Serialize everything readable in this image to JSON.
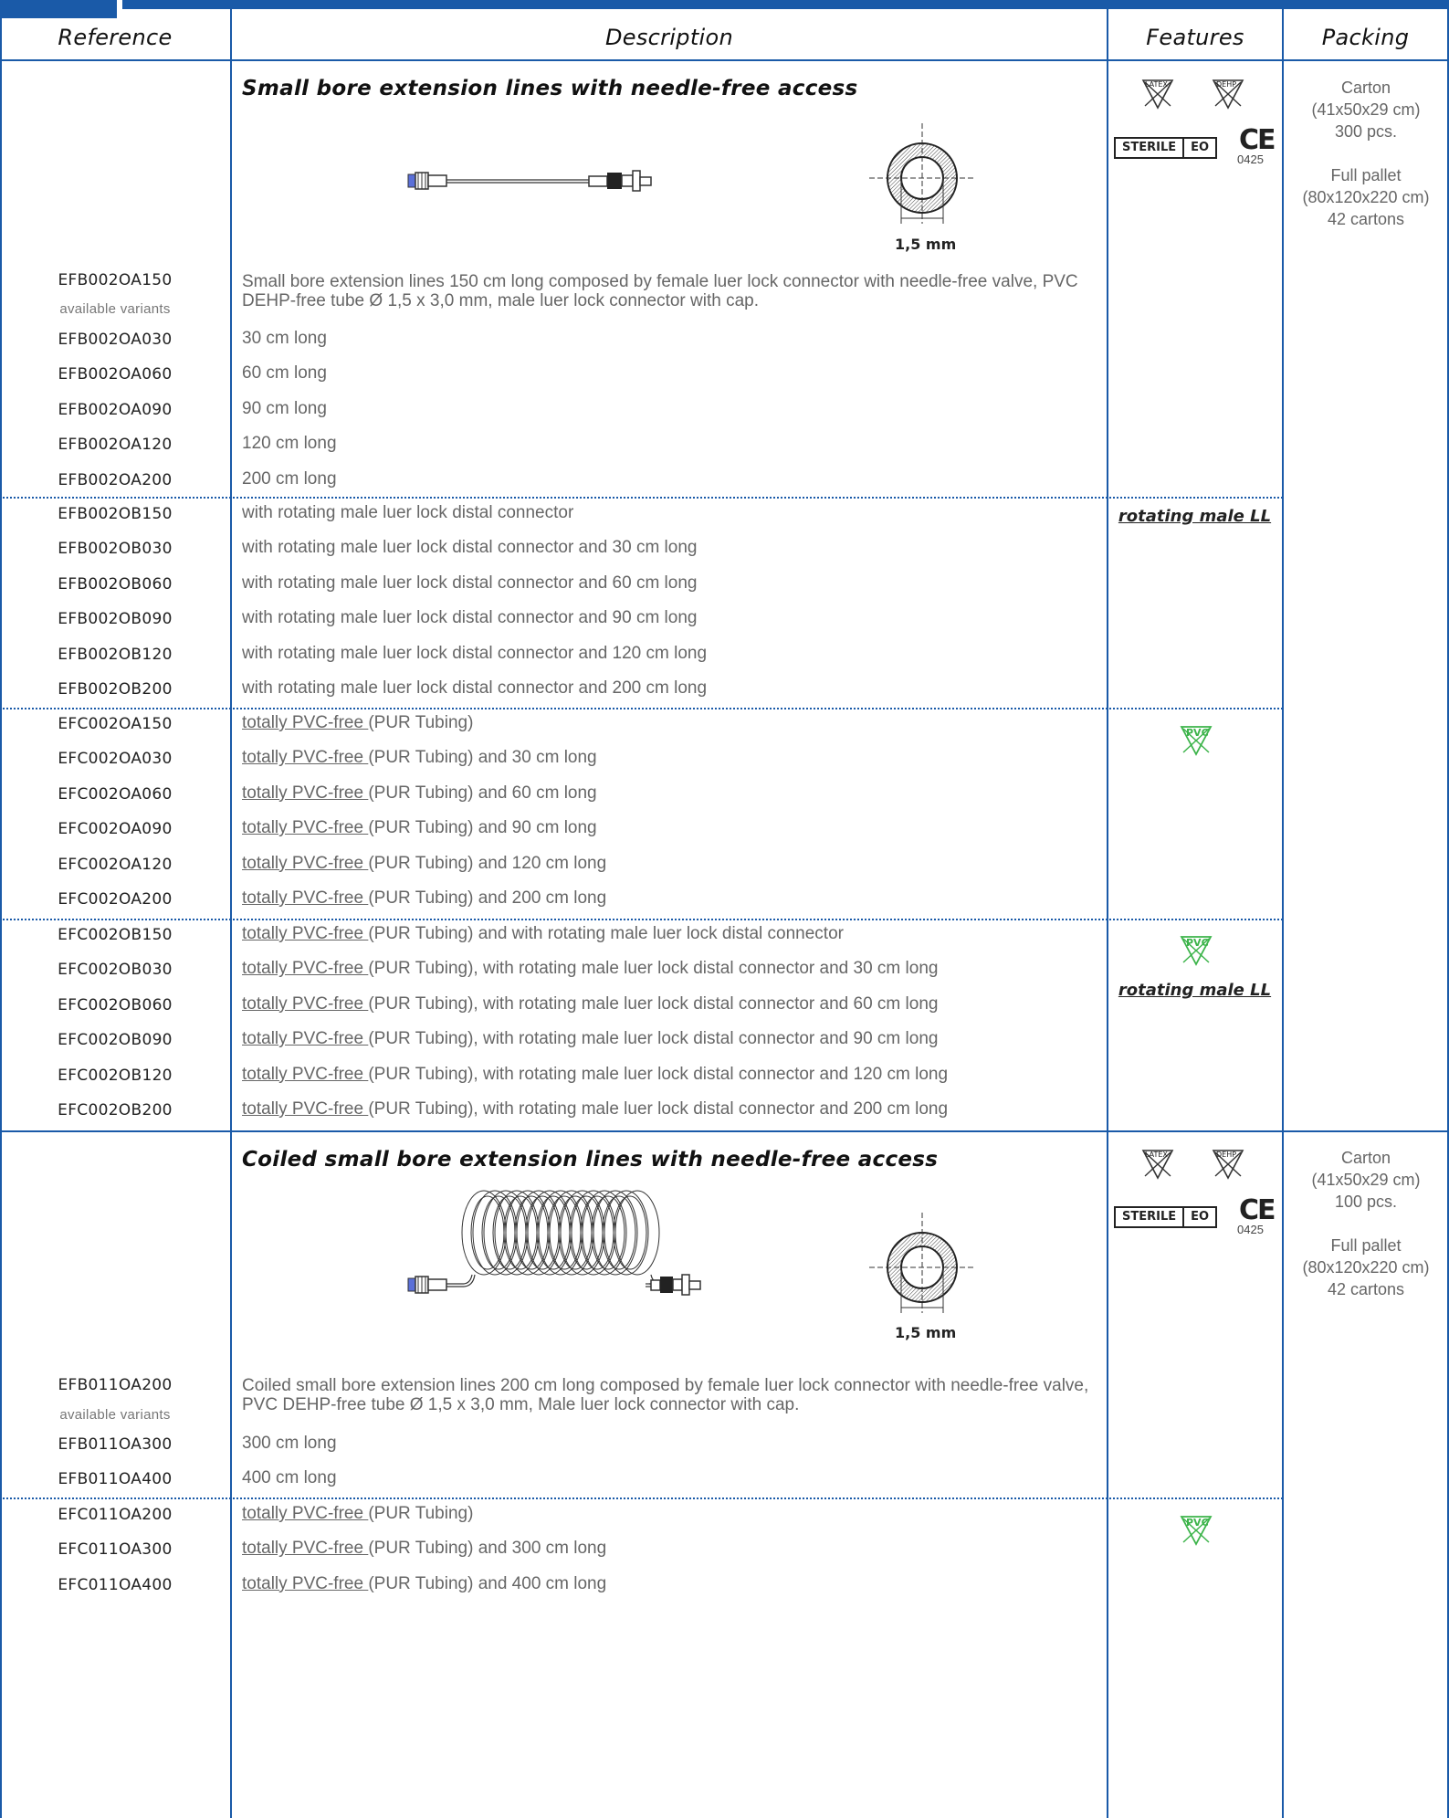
{
  "headers": {
    "reference": "Reference",
    "description": "Description",
    "features": "Features",
    "packing": "Packing"
  },
  "section1": {
    "title": "Small bore extension lines with needle-free access",
    "diameter_label": "1,5 mm",
    "main_ref": "EFB002OA150",
    "main_desc": "Small bore extension lines 150 cm long composed by female luer lock connector with needle-free valve, PVC DEHP-free tube Ø 1,5 x 3,0 mm, male luer lock connector with cap.",
    "variants_label": "available variants",
    "packing": [
      "Carton",
      "(41x50x29 cm)",
      "300 pcs.",
      "",
      "Full pallet",
      "(80x120x220 cm)",
      "42 cartons"
    ],
    "features": {
      "latex": "LATEX",
      "dehp": "DEHP",
      "sterile": "STERILE",
      "eo": "EO",
      "ce": "CE",
      "ce_number": "0425",
      "rotating": "rotating male LL",
      "pvc": "PVC"
    },
    "groupA": [
      {
        "ref": "EFB002OA030",
        "pre": "",
        "desc": "30 cm long"
      },
      {
        "ref": "EFB002OA060",
        "pre": "",
        "desc": "60 cm long"
      },
      {
        "ref": "EFB002OA090",
        "pre": "",
        "desc": "90 cm long"
      },
      {
        "ref": "EFB002OA120",
        "pre": "",
        "desc": "120 cm long"
      },
      {
        "ref": "EFB002OA200",
        "pre": "",
        "desc": "200 cm long"
      }
    ],
    "groupB": [
      {
        "ref": "EFB002OB150",
        "pre": "",
        "desc": "with rotating male luer lock distal connector"
      },
      {
        "ref": "EFB002OB030",
        "pre": "",
        "desc": "with rotating male luer lock distal connector and 30 cm long"
      },
      {
        "ref": "EFB002OB060",
        "pre": "",
        "desc": "with rotating male luer lock distal connector and 60 cm long"
      },
      {
        "ref": "EFB002OB090",
        "pre": "",
        "desc": "with rotating male luer lock distal connector and 90 cm long"
      },
      {
        "ref": "EFB002OB120",
        "pre": "",
        "desc": "with rotating male luer lock distal connector and 120 cm long"
      },
      {
        "ref": "EFB002OB200",
        "pre": "",
        "desc": "with rotating male luer lock distal connector and 200 cm long"
      }
    ],
    "groupC": [
      {
        "ref": "EFC002OA150",
        "pre": "totally PVC-free ",
        "desc": "(PUR Tubing)"
      },
      {
        "ref": "EFC002OA030",
        "pre": "totally PVC-free ",
        "desc": "(PUR Tubing) and 30 cm long"
      },
      {
        "ref": "EFC002OA060",
        "pre": "totally PVC-free ",
        "desc": "(PUR Tubing) and 60 cm long"
      },
      {
        "ref": "EFC002OA090",
        "pre": "totally PVC-free ",
        "desc": "(PUR Tubing) and 90 cm long"
      },
      {
        "ref": "EFC002OA120",
        "pre": "totally PVC-free ",
        "desc": "(PUR Tubing) and 120 cm long"
      },
      {
        "ref": "EFC002OA200",
        "pre": "totally PVC-free ",
        "desc": "(PUR Tubing) and 200 cm long"
      }
    ],
    "groupD": [
      {
        "ref": "EFC002OB150",
        "pre": "totally PVC-free ",
        "desc": "(PUR Tubing) and with rotating male luer lock distal connector"
      },
      {
        "ref": "EFC002OB030",
        "pre": "totally PVC-free ",
        "desc": "(PUR Tubing), with rotating male luer lock distal connector and 30 cm long"
      },
      {
        "ref": "EFC002OB060",
        "pre": "totally PVC-free ",
        "desc": "(PUR Tubing), with rotating male luer lock distal connector and 60 cm long"
      },
      {
        "ref": "EFC002OB090",
        "pre": "totally PVC-free ",
        "desc": "(PUR Tubing), with rotating male luer lock distal connector and 90 cm long"
      },
      {
        "ref": "EFC002OB120",
        "pre": "totally PVC-free ",
        "desc": "(PUR Tubing), with rotating male luer lock distal connector and 120 cm long"
      },
      {
        "ref": "EFC002OB200",
        "pre": "totally PVC-free ",
        "desc": "(PUR Tubing), with rotating male luer lock distal connector and 200 cm long"
      }
    ]
  },
  "section2": {
    "title": "Coiled small bore extension lines with needle-free access",
    "diameter_label": "1,5 mm",
    "main_ref": "EFB011OA200",
    "main_desc": "Coiled small bore extension lines 200 cm long composed by female luer lock connector with needle-free valve, PVC DEHP-free tube Ø 1,5 x 3,0 mm, Male luer lock connector with cap.",
    "variants_label": "available variants",
    "packing": [
      "Carton",
      "(41x50x29 cm)",
      "100 pcs.",
      "",
      "Full pallet",
      "(80x120x220 cm)",
      "42 cartons"
    ],
    "groupA": [
      {
        "ref": "EFB011OA300",
        "pre": "",
        "desc": "300 cm long"
      },
      {
        "ref": "EFB011OA400",
        "pre": "",
        "desc": "400 cm long"
      }
    ],
    "groupC": [
      {
        "ref": "EFC011OA200",
        "pre": "totally PVC-free ",
        "desc": "(PUR Tubing)"
      },
      {
        "ref": "EFC011OA300",
        "pre": "totally PVC-free ",
        "desc": "(PUR Tubing) and 300 cm long"
      },
      {
        "ref": "EFC011OA400",
        "pre": "totally PVC-free ",
        "desc": "(PUR Tubing) and 400 cm long"
      }
    ]
  }
}
